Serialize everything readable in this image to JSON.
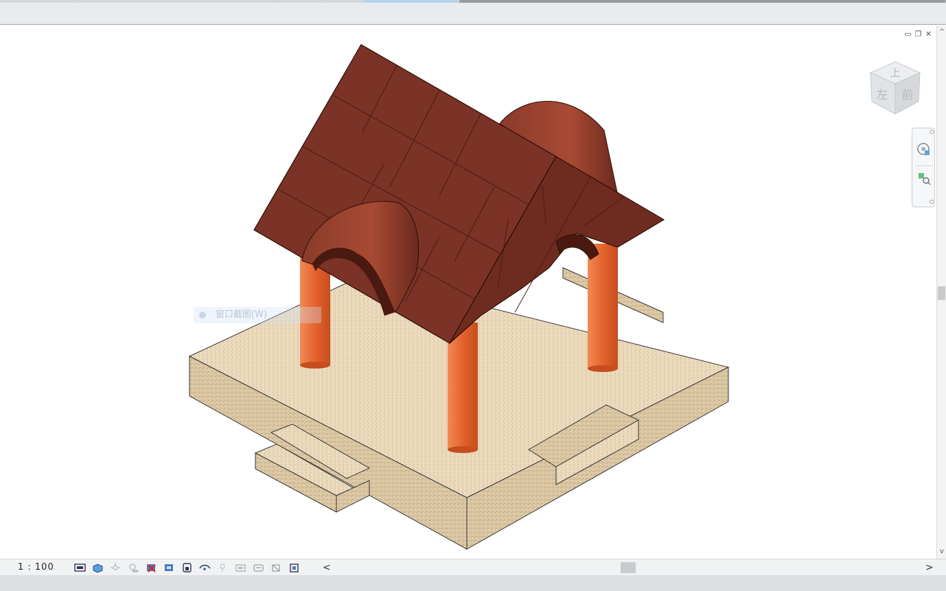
{
  "window": {
    "controls": {
      "minimize": "▭",
      "restore": "❐",
      "close": "✕"
    }
  },
  "viewcube": {
    "top": "上",
    "left": "左",
    "front": "前"
  },
  "ghost_menu": {
    "label": "窗口截图(W)"
  },
  "statusbar": {
    "scale": "1 : 100",
    "icons": [
      "detail-level-icon",
      "visual-style-icon",
      "sun-path-icon",
      "shadows-icon",
      "crop-view-icon",
      "show-crop-icon",
      "lock-3d-view-icon",
      "temporary-hide-icon",
      "reveal-hidden-icon",
      "worksharing-icon",
      "design-options-icon",
      "analytical-model-icon",
      "highlight-displacement-icon",
      "constraints-icon"
    ],
    "left_arrow": "<",
    "right_arrow": ">"
  },
  "colors": {
    "roof": "#7a3326",
    "roof_dark": "#5a2117",
    "column": "#e4632c",
    "base_top": "#ead9bb",
    "base_side": "#dccaa8"
  }
}
